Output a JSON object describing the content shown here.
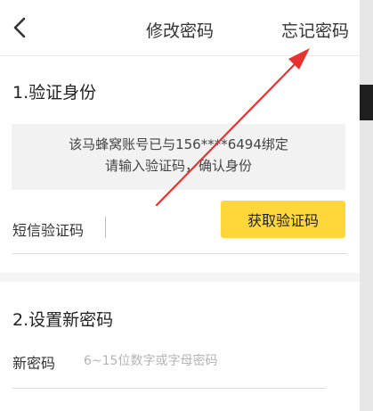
{
  "header": {
    "back_icon": "chevron-left-icon",
    "title": "修改密码",
    "forget_password": "忘记密码"
  },
  "verify": {
    "title": "1.验证身份",
    "info_line1": "该马蜂窝账号已与156****6494绑定",
    "info_line2": "请输入验证码，确认身份",
    "sms_label": "短信验证码",
    "get_code_label": "获取验证码"
  },
  "new_password": {
    "title": "2.设置新密码",
    "label": "新密码",
    "placeholder": "6~15位数字或字母密码"
  },
  "colors": {
    "accent": "#ffd73b",
    "annotation_arrow": "#e8322f"
  }
}
